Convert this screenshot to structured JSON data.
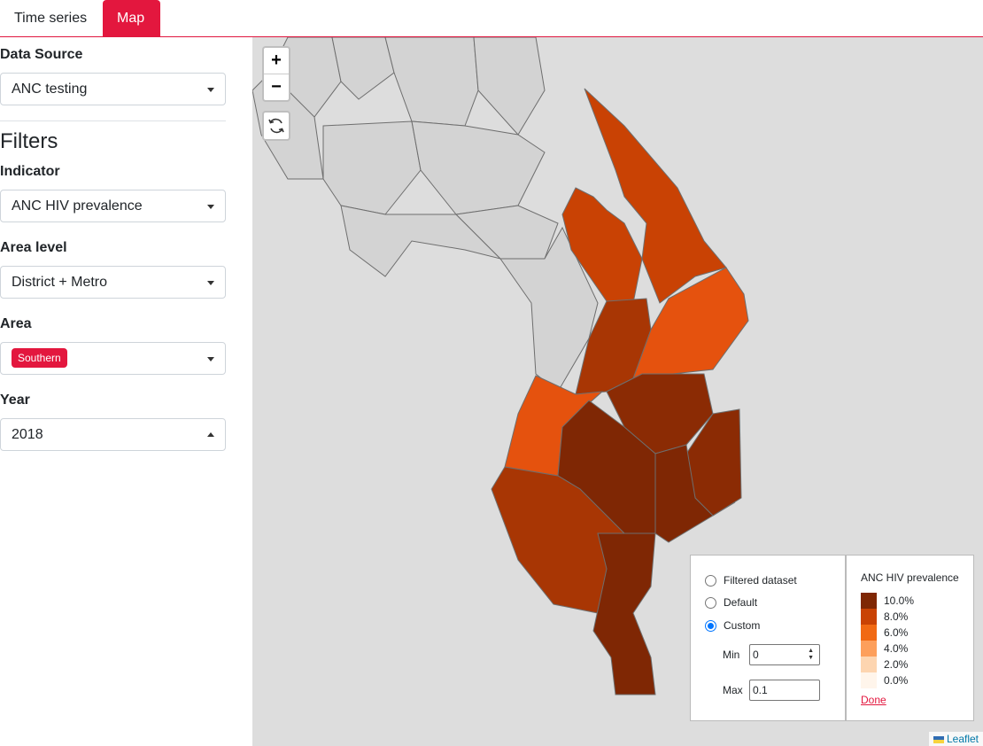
{
  "tabs": [
    {
      "label": "Time series",
      "active": false
    },
    {
      "label": "Map",
      "active": true
    }
  ],
  "sidebar": {
    "data_source": {
      "label": "Data Source",
      "value": "ANC testing"
    },
    "filters_heading": "Filters",
    "indicator": {
      "label": "Indicator",
      "value": "ANC HIV prevalence"
    },
    "area_level": {
      "label": "Area level",
      "value": "District + Metro"
    },
    "area": {
      "label": "Area",
      "tag": "Southern"
    },
    "year": {
      "label": "Year",
      "value": "2018"
    }
  },
  "map": {
    "zoom_in": "+",
    "zoom_out": "−",
    "reset_icon": "refresh-icon",
    "scale_options": [
      {
        "label": "Filtered dataset",
        "selected": false
      },
      {
        "label": "Default",
        "selected": false
      },
      {
        "label": "Custom",
        "selected": true
      }
    ],
    "custom": {
      "min_label": "Min",
      "min_value": "0",
      "max_label": "Max",
      "max_value": "0.1"
    },
    "legend": {
      "title": "ANC HIV prevalence",
      "items": [
        {
          "label": "10.0%",
          "color": "#7f2704"
        },
        {
          "label": "8.0%",
          "color": "#c94204"
        },
        {
          "label": "6.0%",
          "color": "#f16913"
        },
        {
          "label": "4.0%",
          "color": "#fd9f5b"
        },
        {
          "label": "2.0%",
          "color": "#fdd5b0"
        },
        {
          "label": "0.0%",
          "color": "#fff5eb"
        }
      ],
      "done_label": "Done"
    },
    "attribution": "Leaflet"
  },
  "colors": {
    "accent": "#e3173e",
    "outside_area": "#d3d3d3",
    "map_bg": "#dddddd"
  }
}
